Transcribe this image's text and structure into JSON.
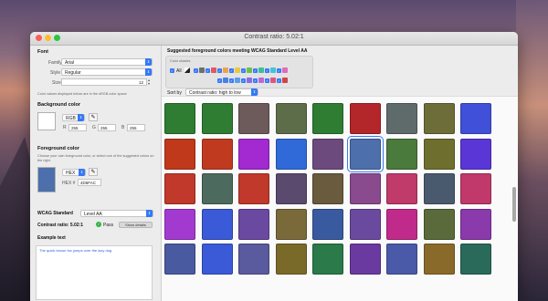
{
  "window": {
    "title": "Contrast ratio: 5.02:1"
  },
  "font": {
    "section": "Font",
    "family_label": "Family",
    "family_value": "Arial",
    "style_label": "Style",
    "style_value": "Regular",
    "size_label": "Size",
    "size_value": "12"
  },
  "note": "Color values displayed below are in the sRGB color space",
  "background": {
    "section": "Background color",
    "mode": "RGB",
    "r_label": "R",
    "r_value": "255",
    "g_label": "G",
    "g_value": "255",
    "b_label": "B",
    "b_value": "255",
    "swatch_color": "#ffffff"
  },
  "foreground": {
    "section": "Foreground color",
    "description": "Choose your own foreground color, or select one of the suggested colors on the right.",
    "mode": "HEX",
    "hex_label": "HEX #",
    "hex_value": "4D6FAC",
    "swatch_color": "#4d6fac"
  },
  "wcag": {
    "label": "WCAG Standard",
    "value": "Level AA",
    "contrast_label": "Contrast ratio: 5.02:1",
    "pass_label": "Pass",
    "details_button": "Show details"
  },
  "example": {
    "label": "Example text",
    "text": "The quick brown fox jumps over the lazy dog"
  },
  "suggested": {
    "heading": "Suggested foreground colors meeting WCAG Standard Level AA",
    "shades_label": "Color shades",
    "all_label": "All",
    "sort_label": "Sort by",
    "sort_value": "Contrast ratio: high to low"
  },
  "shade_colors_row1": [
    "#6e6e6e",
    "#e05a5a",
    "#f0a04b",
    "#e8c93a",
    "#6cc04a",
    "#3fbf8f",
    "#42c4d4",
    "#e06bbd"
  ],
  "shade_colors_row2": [
    "#4a7fe0",
    "#5a9de8",
    "#8a6be0",
    "#c265d6",
    "#e0557a",
    "#d04545"
  ],
  "grid_colors": [
    [
      "#2e7d32",
      "#2e7d32",
      "#6d5a5a",
      "#5d6d4a",
      "#2e7d32",
      "#b3262a",
      "#5f6b6b",
      "#6d6d3a",
      "#4050d8"
    ],
    [
      "#c0391b",
      "#c03a20",
      "#a22ad0",
      "#2f6ad8",
      "#6d4a7d",
      "#4d6fac",
      "#4a7a3c",
      "#6e6e2e",
      "#5a36d6"
    ],
    [
      "#c0392b",
      "#4d6a5e",
      "#c0392b",
      "#5a4a6e",
      "#6a5a3e",
      "#8a4a8e",
      "#c03a6a",
      "#4a5a6e",
      "#c0396a"
    ],
    [
      "#a23ad0",
      "#3a5ad8",
      "#6a4aa0",
      "#7a6a3a",
      "#3a5aa0",
      "#6a4a9e",
      "#c02a8a",
      "#5a6a3a",
      "#8a3aaa"
    ],
    [
      "#4a5aa0",
      "#3a5ad8",
      "#5a5a9e",
      "#7a6a2a",
      "#2a7a4a",
      "#6a3aa0",
      "#4a5aa8",
      "#8a6a2a",
      "#2a6a5a"
    ]
  ]
}
